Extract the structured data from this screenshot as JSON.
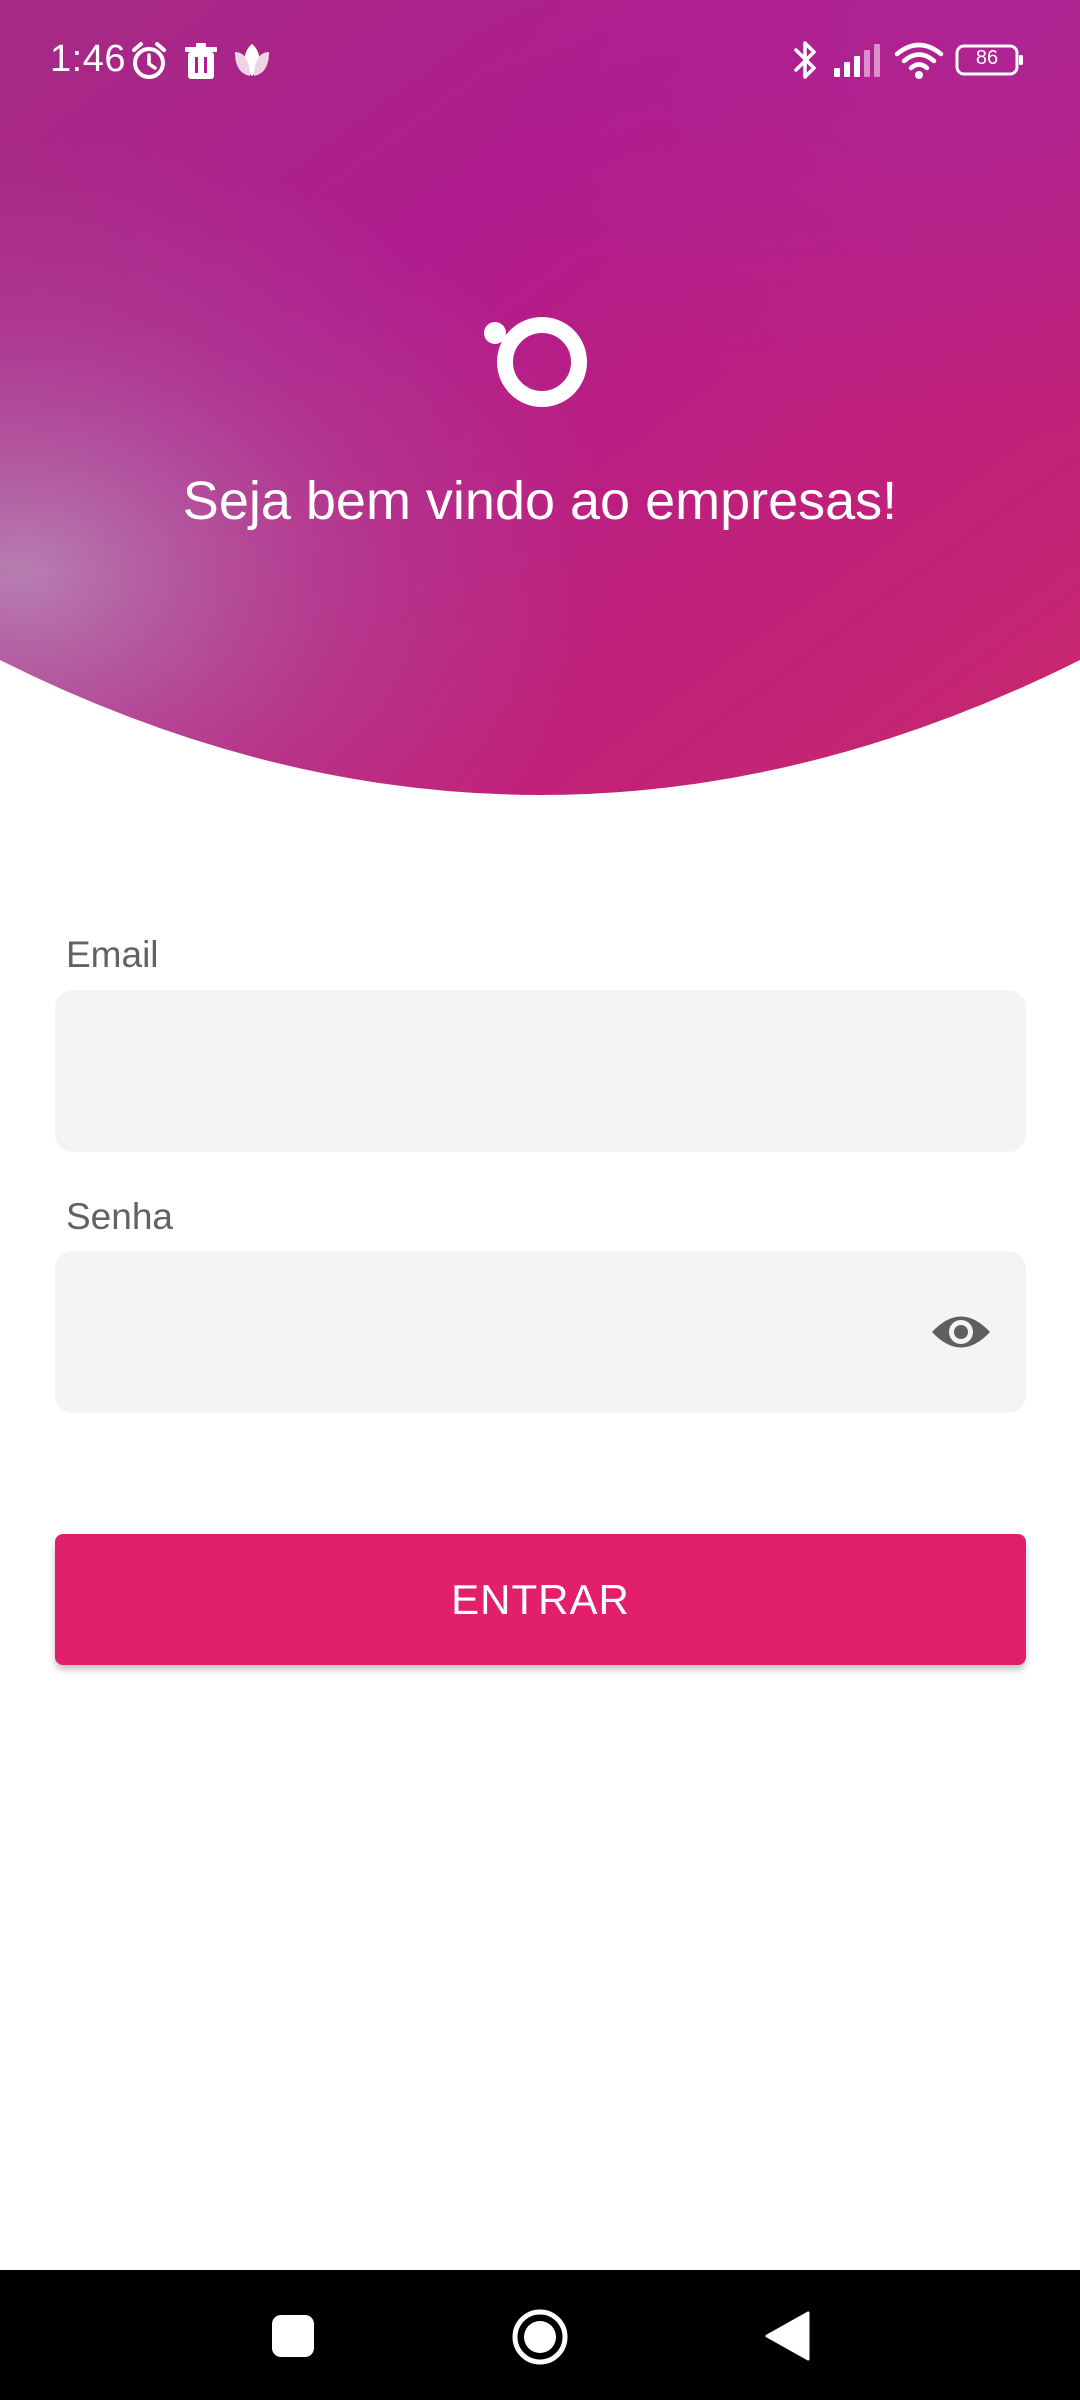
{
  "status_bar": {
    "time": "1:46",
    "battery": "86",
    "icons": [
      "alarm-icon",
      "trash-icon",
      "lotus-icon",
      "bluetooth-icon",
      "signal-icon",
      "wifi-icon",
      "battery-icon"
    ]
  },
  "header": {
    "welcome_text": "Seja bem vindo ao empresas!",
    "logo_icon": "brand-logo-icon"
  },
  "form": {
    "email_label": "Email",
    "email_value": "",
    "password_label": "Senha",
    "password_value": "",
    "password_toggle_icon": "eye-icon",
    "submit_label": "ENTRAR"
  },
  "nav_bar": {
    "icons": [
      "recents-icon",
      "home-icon",
      "back-icon"
    ]
  },
  "colors": {
    "primary": "#e21f6b",
    "header_gradient": [
      "#a82089",
      "#b41c8f",
      "#c8246e",
      "#b07bb0"
    ],
    "field_bg": "#f4f4f4"
  }
}
